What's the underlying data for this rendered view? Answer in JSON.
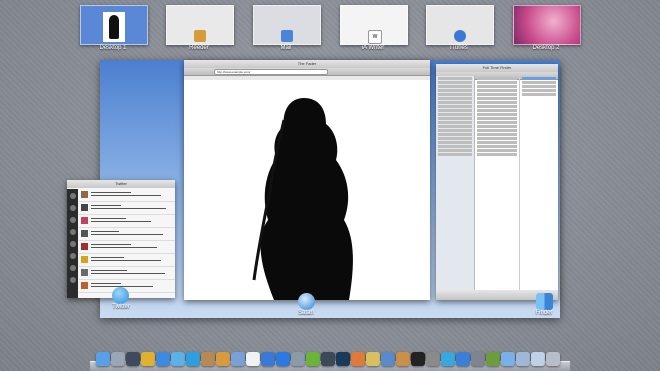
{
  "spaces": [
    {
      "label": "Desktop 1",
      "bg": "#5a87d6"
    },
    {
      "label": "Reeder",
      "bg": "#e9e9e9",
      "badge": "#d69b3a"
    },
    {
      "label": "Mail",
      "bg": "#dcdde2",
      "badge": "#4b86d6"
    },
    {
      "label": "iA Writer",
      "bg": "#f4f4f4",
      "badge": "#ffffff"
    },
    {
      "label": "iTunes",
      "bg": "#e6e6e6",
      "badge": "#3a7ad6"
    },
    {
      "label": "Desktop 2",
      "bg": "#d86aa0"
    }
  ],
  "windows": {
    "safari": {
      "label": "Safari",
      "title": "The Fader",
      "url": "http://www.example.com/"
    },
    "twitter": {
      "label": "Twitter",
      "title": "Twitter",
      "count": 12
    },
    "finder": {
      "label": "Finder",
      "title": "Full Time Finder"
    }
  },
  "dock": {
    "icons": [
      {
        "name": "finder-icon",
        "color": "#5aa0e8"
      },
      {
        "name": "launchpad-icon",
        "color": "#9aa5b5"
      },
      {
        "name": "mission-control-icon",
        "color": "#3f4a5c"
      },
      {
        "name": "chrome-icon",
        "color": "#e0b030"
      },
      {
        "name": "safari-icon",
        "color": "#3d8be0"
      },
      {
        "name": "twitter-icon",
        "color": "#5ab2e8"
      },
      {
        "name": "skype-icon",
        "color": "#2e9ee0"
      },
      {
        "name": "address-book-icon",
        "color": "#b58a55"
      },
      {
        "name": "reeder-icon",
        "color": "#d69b3a"
      },
      {
        "name": "mail-icon",
        "color": "#7aa0d8"
      },
      {
        "name": "ia-writer-icon",
        "color": "#f2f2f2"
      },
      {
        "name": "itunes-icon",
        "color": "#3a7ad6"
      },
      {
        "name": "app-store-icon",
        "color": "#2a7ae0"
      },
      {
        "name": "preview-icon",
        "color": "#8a9aa8"
      },
      {
        "name": "evernote-icon",
        "color": "#6ab43a"
      },
      {
        "name": "lightroom-icon",
        "color": "#3a4a5a"
      },
      {
        "name": "photoshop-icon",
        "color": "#1a3a5a"
      },
      {
        "name": "coda-icon",
        "color": "#e07a3a"
      },
      {
        "name": "transmit-icon",
        "color": "#d8c060"
      },
      {
        "name": "sparrow-icon",
        "color": "#5a8ac8"
      },
      {
        "name": "garageband-icon",
        "color": "#c89048"
      },
      {
        "name": "terminal-icon",
        "color": "#222222"
      },
      {
        "name": "system-preferences-icon",
        "color": "#8a8a8a"
      },
      {
        "name": "skype-2-icon",
        "color": "#39a7e0"
      },
      {
        "name": "dropbox-icon",
        "color": "#3a80d8"
      },
      {
        "name": "utilities-icon",
        "color": "#7f858e"
      },
      {
        "name": "game-icon",
        "color": "#6c9c3c"
      },
      {
        "name": "downloads-icon",
        "color": "#7ab0e8"
      },
      {
        "name": "documents-icon",
        "color": "#9fb8d8"
      },
      {
        "name": "applications-icon",
        "color": "#c0d0e8"
      },
      {
        "name": "trash-icon",
        "color": "#b8bec8"
      }
    ]
  }
}
